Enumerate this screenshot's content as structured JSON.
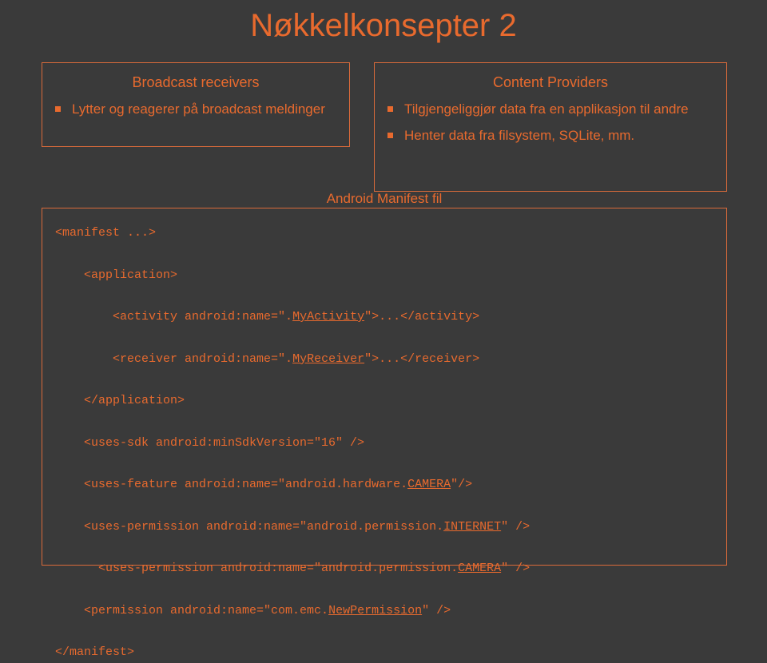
{
  "title": "Nøkkelkonsepter 2",
  "left": {
    "heading": "Broadcast receivers",
    "bullet1": "Lytter og reagerer på broadcast meldinger"
  },
  "right": {
    "heading": "Content Providers",
    "bullet1": "Tilgjengeliggjør data fra en applikasjon til andre",
    "bullet2": "Henter data fra filsystem, SQLite, mm."
  },
  "manifest": {
    "label": "Android Manifest fil",
    "l1a": "<manifest ...>",
    "l2a": "    <application>",
    "l3a": "        <activity android:name=\".",
    "l3b": "MyActivity",
    "l3c": "\">...</activity>",
    "l4a": "        <receiver android:name=\".",
    "l4b": "MyReceiver",
    "l4c": "\">...</receiver>",
    "l5a": "    </application>",
    "l6a": "    <uses-sdk android:minSdkVersion=\"16\" />",
    "l7a": "    <uses-feature android:name=\"android.hardware.",
    "l7b": "CAMERA",
    "l7c": "\"/>",
    "l8a": "    <uses-permission android:name=\"android.permission.",
    "l8b": "INTERNET",
    "l8c": "\" />",
    "l9a": "      <uses-permission android:name=\"android.permission.",
    "l9b": "CAMERA",
    "l9c": "\" />",
    "l10a": "    <permission android:name=\"com.emc.",
    "l10b": "NewPermission",
    "l10c": "\" />",
    "l11a": "</manifest>"
  }
}
